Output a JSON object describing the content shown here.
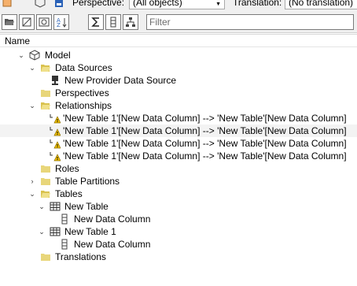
{
  "toolbar_top": {
    "perspective_label": "Perspective:",
    "perspective_value": "(All objects)",
    "translation_label": "Translation:",
    "translation_value": "(No translation)"
  },
  "toolbar": {
    "filter_placeholder": "Filter",
    "buttons": [
      {
        "name": "open-folder-icon"
      },
      {
        "name": "hide-icon"
      },
      {
        "name": "link-icon"
      },
      {
        "name": "sort-az-icon"
      },
      {
        "name": "sum-icon"
      },
      {
        "name": "column-icon"
      },
      {
        "name": "hierarchy-icon"
      }
    ]
  },
  "header": {
    "name_column": "Name"
  },
  "tree": {
    "model": "Model",
    "data_sources": "Data Sources",
    "new_provider_data_source": "New Provider Data Source",
    "perspectives": "Perspectives",
    "relationships": "Relationships",
    "relationship_items": [
      "'New Table 1'[New Data Column] --> 'New Table'[New Data Column]",
      "'New Table 1'[New Data Column] --> 'New Table'[New Data Column]",
      "'New Table 1'[New Data Column] --> 'New Table'[New Data Column]",
      "'New Table 1'[New Data Column] --> 'New Table'[New Data Column]"
    ],
    "roles": "Roles",
    "table_partitions": "Table Partitions",
    "tables": "Tables",
    "new_table": "New Table",
    "new_table_column": "New Data Column",
    "new_table_1": "New Table 1",
    "new_table_1_column": "New Data Column",
    "translations": "Translations"
  },
  "colors": {
    "folder": "#e8d67a",
    "warning": "#f2c200",
    "row_highlight": "#f3f3f3"
  }
}
